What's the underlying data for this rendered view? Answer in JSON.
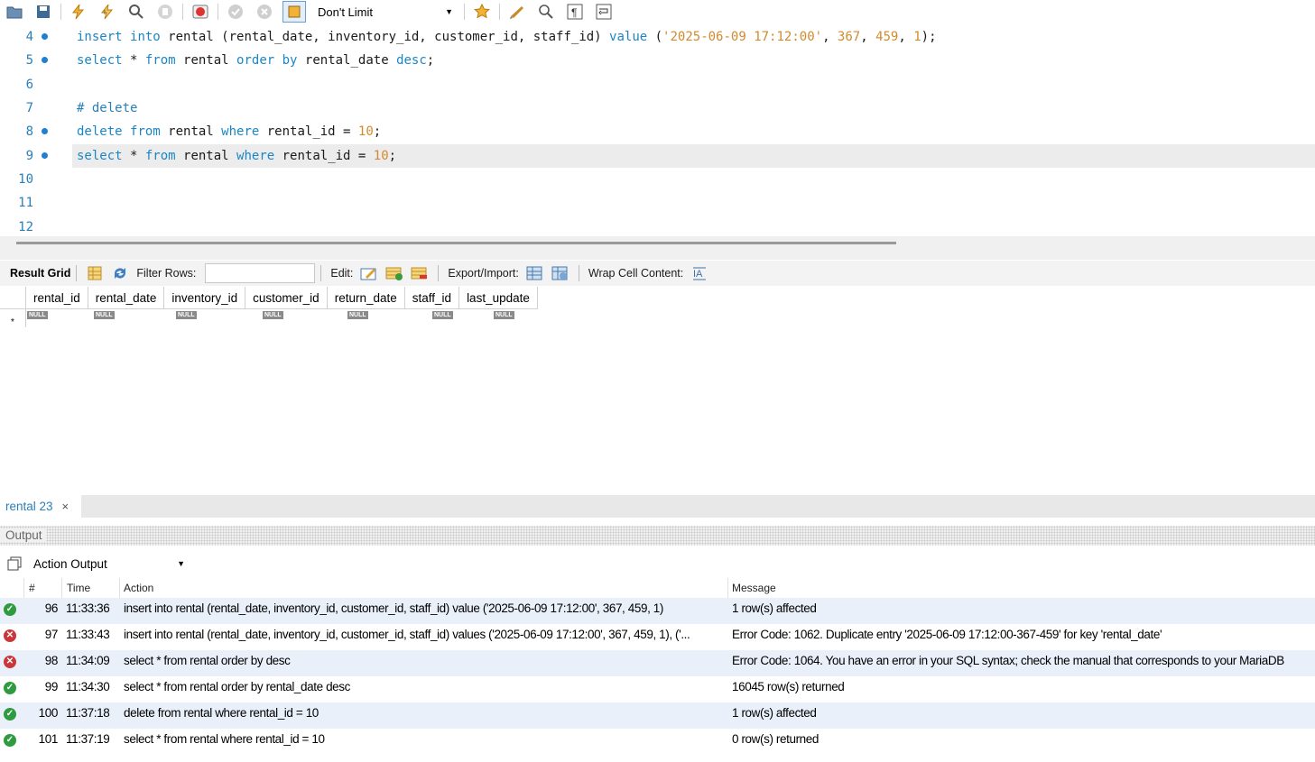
{
  "toolbar": {
    "limit_value": "Don't Limit",
    "icons": [
      "open-folder-icon",
      "save-icon",
      "execute-icon",
      "execute-current-icon",
      "explain-icon",
      "stop-icon",
      "toggle-error-icon",
      "commit-icon",
      "rollback-icon",
      "autocommit-icon",
      "bookmark-icon",
      "beautify-icon",
      "find-icon",
      "invisible-chars-icon",
      "wrap-icon"
    ]
  },
  "editor": {
    "lines": [
      {
        "n": "4",
        "dot": true
      },
      {
        "n": "5",
        "dot": true
      },
      {
        "n": "6",
        "dot": false
      },
      {
        "n": "7",
        "dot": false
      },
      {
        "n": "8",
        "dot": true
      },
      {
        "n": "9",
        "dot": true
      },
      {
        "n": "10",
        "dot": false
      },
      {
        "n": "11",
        "dot": false
      },
      {
        "n": "12",
        "dot": false
      }
    ],
    "code": {
      "l4": {
        "a": "insert",
        "b": " ",
        "c": "into",
        "d": " rental (rental_date, inventory_id, customer_id, staff_id) ",
        "e": "value",
        "f": " (",
        "g": "'2025-06-09 17:12:00'",
        "h": ", ",
        "i": "367",
        "j": ", ",
        "k": "459",
        "l": ", ",
        "m": "1",
        "n": ");"
      },
      "l5": {
        "a": "select",
        "b": " * ",
        "c": "from",
        "d": " rental ",
        "e": "order",
        "f": " ",
        "g": "by",
        "h": " rental_date ",
        "i": "desc",
        "j": ";"
      },
      "l7": {
        "a": "# delete"
      },
      "l8": {
        "a": "delete",
        "b": " ",
        "c": "from",
        "d": " rental ",
        "e": "where",
        "f": " rental_id = ",
        "g": "10",
        "h": ";"
      },
      "l9": {
        "a": "select",
        "b": " * ",
        "c": "from",
        "d": " rental ",
        "e": "where",
        "f": " rental_id = ",
        "g": "10",
        "h": ";"
      }
    }
  },
  "result_bar": {
    "result_grid_label": "Result Grid",
    "filter_label": "Filter Rows:",
    "filter_value": "",
    "edit_label": "Edit:",
    "export_label": "Export/Import:",
    "wrap_label": "Wrap Cell Content:"
  },
  "grid": {
    "columns": [
      "rental_id",
      "rental_date",
      "inventory_id",
      "customer_id",
      "return_date",
      "staff_id",
      "last_update"
    ],
    "new_row_marker": "*",
    "null_label": "NULL"
  },
  "tabs": [
    {
      "label": "rental 23",
      "close": "×"
    }
  ],
  "output": {
    "title": "Output",
    "selector": "Action Output",
    "headers": {
      "num": "#",
      "time": "Time",
      "action": "Action",
      "message": "Message"
    },
    "rows": [
      {
        "status": "ok",
        "num": "96",
        "time": "11:33:36",
        "action": "insert into rental (rental_date, inventory_id, customer_id, staff_id) value ('2025-06-09 17:12:00', 367, 459, 1)",
        "message": "1 row(s) affected"
      },
      {
        "status": "err",
        "num": "97",
        "time": "11:33:43",
        "action": "insert into rental (rental_date, inventory_id, customer_id, staff_id)  values ('2025-06-09 17:12:00', 367, 459, 1), ('...",
        "message": "Error Code: 1062. Duplicate entry '2025-06-09 17:12:00-367-459' for key 'rental_date'"
      },
      {
        "status": "err",
        "num": "98",
        "time": "11:34:09",
        "action": "select * from rental order by desc",
        "message": "Error Code: 1064. You have an error in your SQL syntax; check the manual that corresponds to your MariaDB"
      },
      {
        "status": "ok",
        "num": "99",
        "time": "11:34:30",
        "action": "select * from rental order by rental_date desc",
        "message": "16045 row(s) returned"
      },
      {
        "status": "ok",
        "num": "100",
        "time": "11:37:18",
        "action": "delete from rental where rental_id = 10",
        "message": "1 row(s) affected"
      },
      {
        "status": "ok",
        "num": "101",
        "time": "11:37:19",
        "action": "select * from rental where rental_id = 10",
        "message": "0 row(s) returned"
      }
    ]
  }
}
